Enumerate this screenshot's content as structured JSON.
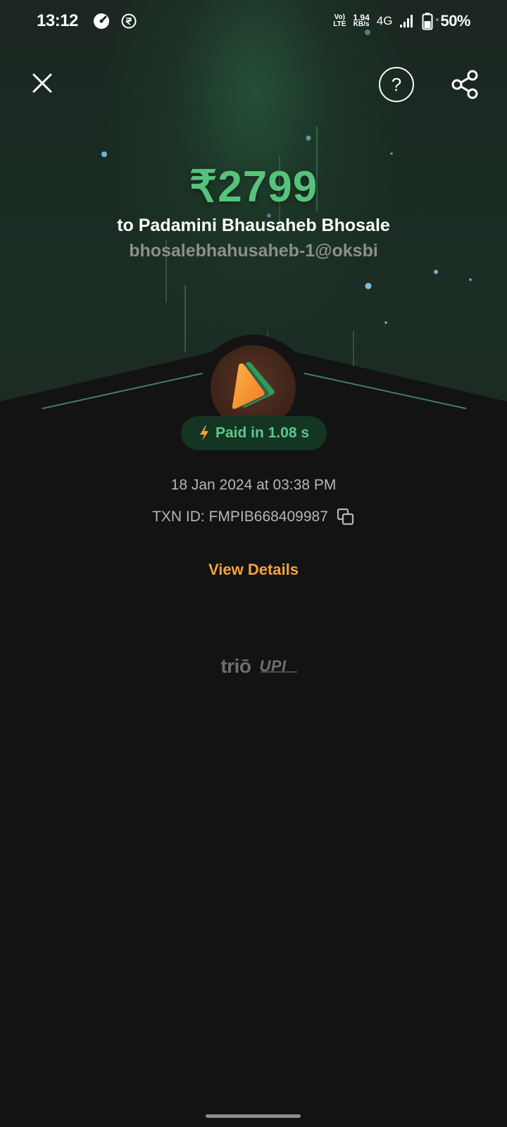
{
  "status_bar": {
    "time": "13:12",
    "network_top": "Vo)",
    "network_bottom": "LTE",
    "speed_value": "1.94",
    "speed_unit": "KB/s",
    "network_type": "4G",
    "battery": "50%"
  },
  "header": {
    "close_icon": "close-icon",
    "help_label": "?",
    "share_icon": "share-icon"
  },
  "payment": {
    "amount": "₹2799",
    "payee_name": "to Padamini Bhausaheb Bhosale",
    "payee_vpa": "bhosalebhahusaheb-1@oksbi",
    "paid_badge": "Paid in 1.08 s",
    "date_time": "18 Jan 2024 at 03:38 PM",
    "txn_id": "TXN ID: FMPIB668409987",
    "view_details": "View Details"
  },
  "branding": {
    "app_logo_text": "triō",
    "upi_logo_text": "UPI"
  },
  "colors": {
    "amount_green": "#58c27d",
    "badge_bg": "#143522",
    "badge_text": "#5cc889",
    "link_orange": "#f1a33e",
    "background": "#131313"
  }
}
